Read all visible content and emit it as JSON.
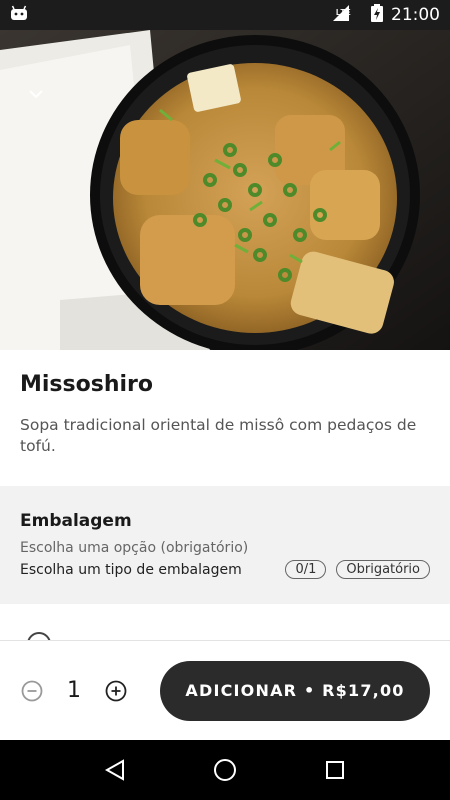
{
  "status_bar": {
    "time": "21:00",
    "network": "LTE",
    "icons": [
      "android-icon",
      "signal-icon",
      "battery-charging-icon"
    ]
  },
  "product": {
    "title": "Missoshiro",
    "description": "Sopa tradicional oriental de missô com pedaços de tofú."
  },
  "packaging": {
    "title": "Embalagem",
    "subtitle": "Escolha uma opção (obrigatório)",
    "instruction": "Escolha um tipo de embalagem",
    "count": "0/1",
    "required_badge": "Obrigatório"
  },
  "cart": {
    "quantity": "1",
    "add_label": "ADICIONAR • R$17,00"
  },
  "colors": {
    "status_bar": "#1c1c1c",
    "button": "#2b2b2b",
    "section_bg": "#f2f2f2",
    "nav_bar": "#000000"
  }
}
